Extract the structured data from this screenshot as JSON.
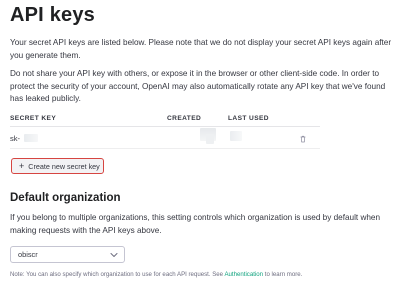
{
  "page": {
    "title": "API keys",
    "intro": "Your secret API keys are listed below. Please note that we do not display your secret API keys again after you generate them.",
    "warning": "Do not share your API key with others, or expose it in the browser or other client-side code. In order to protect the security of your account, OpenAI may also automatically rotate any API key that we've found has leaked publicly."
  },
  "table": {
    "headers": [
      "SECRET KEY",
      "CREATED",
      "LAST USED"
    ],
    "rows": [
      {
        "key_prefix": "sk-",
        "delete_icon": "trash-icon"
      }
    ]
  },
  "create_button": {
    "label": "Create new secret key",
    "icon": "plus-icon"
  },
  "org": {
    "heading": "Default organization",
    "description": "If you belong to multiple organizations, this setting controls which organization is used by default when making requests with the API keys above.",
    "selected": "obiscr",
    "note_prefix": "Note: You can also specify which organization to use for each API request. See ",
    "note_link": "Authentication",
    "note_suffix": " to learn more."
  },
  "colors": {
    "accent": "#10a37f",
    "highlight_border": "#d64541",
    "text": "#353740"
  }
}
